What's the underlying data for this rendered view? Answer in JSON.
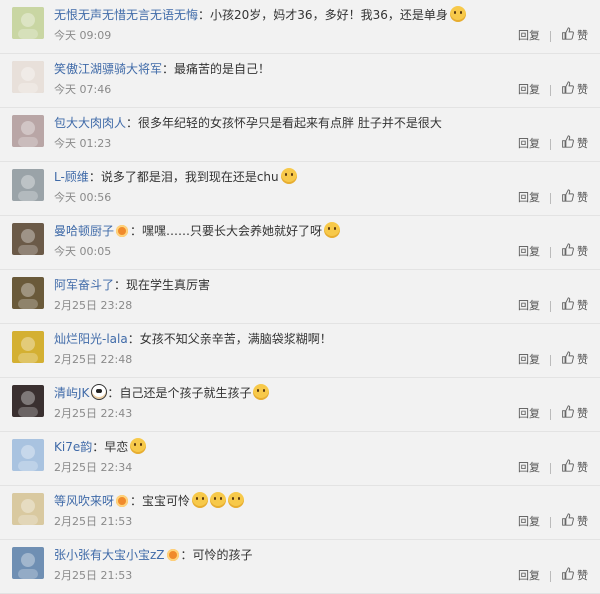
{
  "actions": {
    "reply": "回复",
    "like": "赞"
  },
  "comments": [
    {
      "name": "无恨无声无惜无言无语无悔",
      "text": "小孩20岁，妈才36，多好！我36，还是单身",
      "time": "今天 09:09",
      "badge": false,
      "emojis": 1,
      "avatar_color": "#c9d6a3"
    },
    {
      "name": "笑傲江湖骠骑大将军",
      "text": "最痛苦的是自己！",
      "time": "今天 07:46",
      "badge": false,
      "emojis": 0,
      "avatar_color": "#e8e0da"
    },
    {
      "name": "包大大肉肉人",
      "text": "很多年纪轻的女孩怀孕只是看起来有点胖 肚子并不是很大",
      "time": "今天 01:23",
      "badge": false,
      "emojis": 0,
      "avatar_color": "#b9a6a6"
    },
    {
      "name": "L-顾维",
      "text": "说多了都是泪，我到现在还是chu",
      "time": "今天 00:56",
      "badge": false,
      "emojis": 1,
      "avatar_color": "#9aa3a8"
    },
    {
      "name": "曼哈顿厨子",
      "text": "嘿嘿……只要长大会养她就好了呀",
      "time": "今天 00:05",
      "badge": true,
      "emojis": 1,
      "avatar_color": "#6b5a48"
    },
    {
      "name": "阿军奋斗了",
      "text": "现在学生真厉害",
      "time": "2月25日 23:28",
      "badge": false,
      "emojis": 0,
      "avatar_color": "#6a5a3a"
    },
    {
      "name": "灿烂阳光-lala",
      "text": "女孩不知父亲辛苦，满脑袋浆糊啊！",
      "time": "2月25日 22:48",
      "badge": false,
      "emojis": 0,
      "avatar_color": "#d4b032"
    },
    {
      "name": "清屿JK",
      "text": "自己还是个孩子就生孩子",
      "time": "2月25日 22:43",
      "badge": false,
      "emojis": 1,
      "panda": true,
      "avatar_color": "#3a3030"
    },
    {
      "name": "Ki7e韵",
      "text": "早恋",
      "time": "2月25日 22:34",
      "badge": false,
      "emojis": 1,
      "avatar_color": "#a9c3e0"
    },
    {
      "name": "等风吹来呀",
      "text": "宝宝可怜",
      "time": "2月25日 21:53",
      "badge": true,
      "emojis": 3,
      "avatar_color": "#d9c9a0"
    },
    {
      "name": "张小张有大宝小宝zZ",
      "text": "可怜的孩子",
      "time": "2月25日 21:53",
      "badge": true,
      "emojis": 0,
      "avatar_color": "#6f8fb3"
    }
  ]
}
